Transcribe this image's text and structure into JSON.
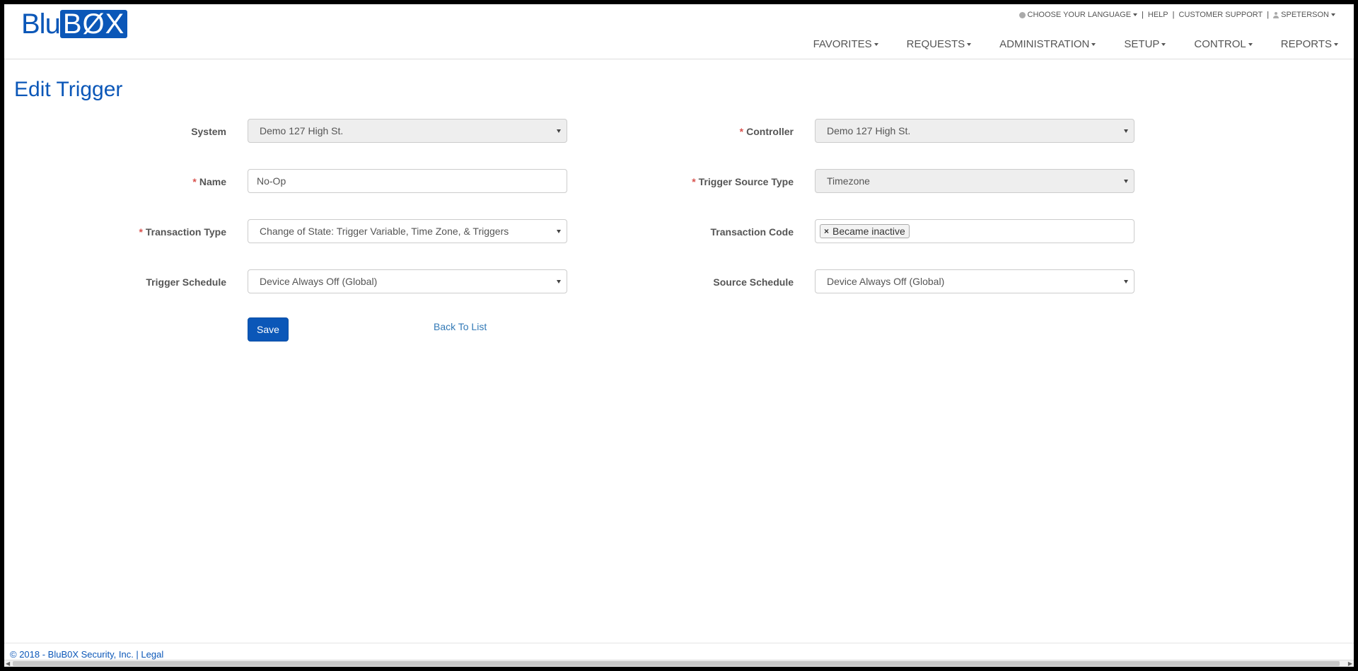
{
  "logo": {
    "part1": "Blu",
    "part2": "BØX"
  },
  "topnav": {
    "language": "CHOOSE YOUR LANGUAGE",
    "help": "HELP",
    "support": "CUSTOMER SUPPORT",
    "user": "SPETERSON",
    "separator": "|"
  },
  "mainnav": {
    "favorites": "FAVORITES",
    "requests": "REQUESTS",
    "administration": "ADMINISTRATION",
    "setup": "SETUP",
    "control": "CONTROL",
    "reports": "REPORTS"
  },
  "page": {
    "title": "Edit Trigger"
  },
  "form": {
    "system": {
      "label": "System",
      "value": "Demo 127 High St."
    },
    "controller": {
      "label": "Controller",
      "value": "Demo 127 High St."
    },
    "name": {
      "label": "Name",
      "value": "No-Op"
    },
    "trigger_source_type": {
      "label": "Trigger Source Type",
      "value": "Timezone"
    },
    "transaction_type": {
      "label": "Transaction Type",
      "value": "Change of State: Trigger Variable, Time Zone, & Triggers"
    },
    "transaction_code": {
      "label": "Transaction Code",
      "tag": "Became inactive",
      "remove": "×"
    },
    "trigger_schedule": {
      "label": "Trigger Schedule",
      "value": "Device Always Off (Global)"
    },
    "source_schedule": {
      "label": "Source Schedule",
      "value": "Device Always Off (Global)"
    },
    "required_mark": "*"
  },
  "actions": {
    "save": "Save",
    "back": "Back To List"
  },
  "footer": {
    "text": "© 2018 - BluB0X Security, Inc. | Legal"
  },
  "colors": {
    "brand": "#0b57b8",
    "required": "#d9534f",
    "link": "#337ab7"
  }
}
